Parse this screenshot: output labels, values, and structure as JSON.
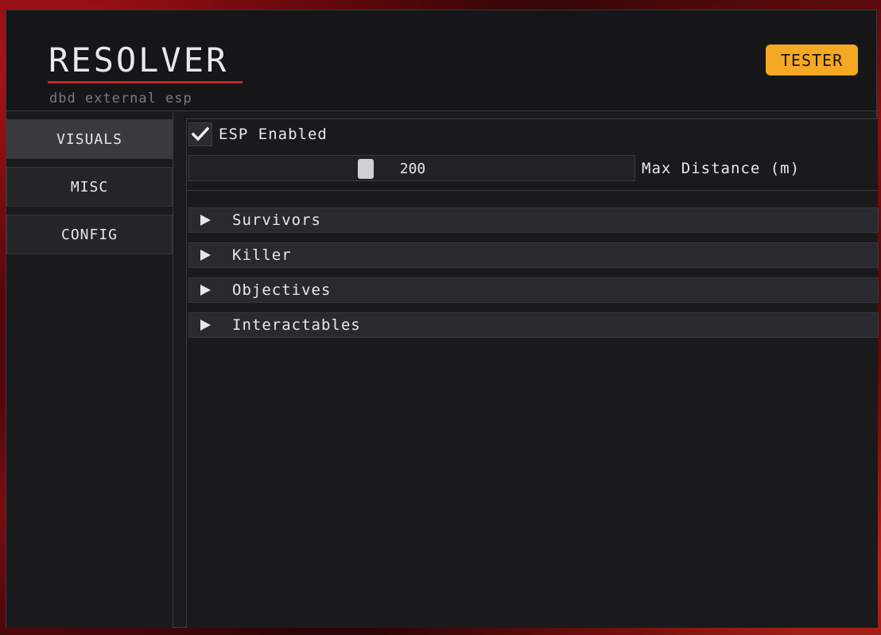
{
  "app": {
    "logo": "RESOLVER",
    "subtitle": "dbd external esp",
    "badge": "TESTER"
  },
  "colors": {
    "accent_underline": "#c8242a",
    "badge": "#f5a823",
    "panel": "#1b1b1d"
  },
  "sidebar": {
    "items": [
      {
        "label": "VISUALS",
        "active": true
      },
      {
        "label": "MISC",
        "active": false
      },
      {
        "label": "CONFIG",
        "active": false
      }
    ]
  },
  "visuals": {
    "esp_enabled": {
      "label": "ESP Enabled",
      "checked": true,
      "icon": "checkmark-icon"
    },
    "max_distance": {
      "label": "Max Distance (m)",
      "value": "200",
      "fill_fraction": 0.39
    },
    "sections": [
      {
        "label": "Survivors",
        "expanded": false,
        "icon": "triangle-right-icon"
      },
      {
        "label": "Killer",
        "expanded": false,
        "icon": "triangle-right-icon"
      },
      {
        "label": "Objectives",
        "expanded": false,
        "icon": "triangle-right-icon"
      },
      {
        "label": "Interactables",
        "expanded": false,
        "icon": "triangle-right-icon"
      }
    ]
  }
}
